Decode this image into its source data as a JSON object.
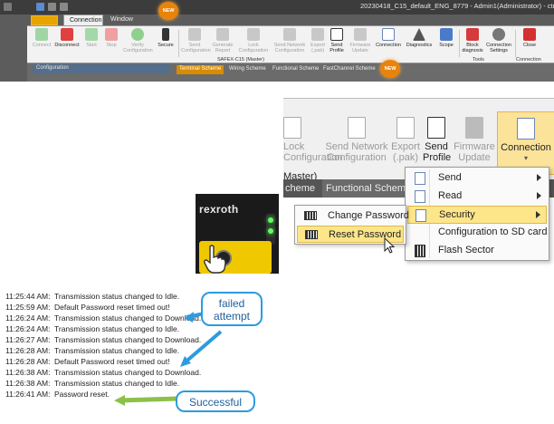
{
  "titlebar": {
    "title": "20230418_C15_default_ENG_8779 - Admin1(Administrator) - ctrlX SAFETY Engineering"
  },
  "ribbon": {
    "tabs": [
      {
        "label": "Connection"
      },
      {
        "label": "Window"
      }
    ],
    "buttons": [
      {
        "label": "Connect",
        "icon": "connect-icon"
      },
      {
        "label": "Disconnect",
        "icon": "disconnect-icon"
      },
      {
        "label": "Start",
        "icon": "play-icon"
      },
      {
        "label": "Stop",
        "icon": "stop-icon"
      },
      {
        "label": "Verify Configuration",
        "icon": "check-icon"
      },
      {
        "label": "Secure",
        "icon": "key-icon"
      },
      {
        "label": "Send Configuration",
        "icon": "send-config-icon"
      },
      {
        "label": "Generate Report",
        "icon": "report-icon"
      },
      {
        "label": "Lock Configuration",
        "icon": "lock-icon"
      },
      {
        "label": "Send Network Configuration",
        "icon": "network-icon"
      },
      {
        "label": "Export (.pak)",
        "icon": "export-icon"
      },
      {
        "label": "Send Profile",
        "icon": "profile-icon"
      },
      {
        "label": "Firmware Update",
        "icon": "firmware-icon"
      },
      {
        "label": "Connection",
        "icon": "connection-icon"
      },
      {
        "label": "Diagnostics",
        "icon": "diagnostics-icon"
      },
      {
        "label": "Scope",
        "icon": "scope-icon"
      },
      {
        "label": "Block diagnosis",
        "icon": "block-icon"
      },
      {
        "label": "Connection Settings",
        "icon": "gear-icon"
      },
      {
        "label": "Close",
        "icon": "close-icon"
      }
    ],
    "group_master": "SAFEX-C15 (Master)",
    "group_tools": "Tools",
    "group_connection": "Connection",
    "new_badge": "NEW"
  },
  "panels": {
    "configuration": "Configuration",
    "doc_tabs": [
      "Terminal Scheme",
      "Wiring Scheme",
      "Functional Scheme",
      "FastChannel Scheme"
    ]
  },
  "zoom": {
    "buttons": [
      {
        "label1": "Lock",
        "label2": "Configuration"
      },
      {
        "label1": "Send Network",
        "label2": "Configuration"
      },
      {
        "label1": "Export",
        "label2": "(.pak)"
      },
      {
        "label1": "Send",
        "label2": "Profile"
      },
      {
        "label1": "Firmware",
        "label2": "Update"
      },
      {
        "label1": "Connection",
        "label2": ""
      }
    ],
    "master": "Master)",
    "bar_left": "cheme",
    "bar_functional": "Functional Scheme"
  },
  "dropdown": {
    "items": [
      {
        "label": "Send",
        "submenu": true
      },
      {
        "label": "Read",
        "submenu": true
      },
      {
        "label": "Security",
        "submenu": true
      },
      {
        "label": "Configuration to SD card",
        "submenu": false
      },
      {
        "label": "Flash Sector",
        "submenu": false
      }
    ]
  },
  "submenu": {
    "items": [
      {
        "label": "Change Password"
      },
      {
        "label": "Reset Password"
      }
    ]
  },
  "device": {
    "brand": "rexroth"
  },
  "log": [
    {
      "time": "11:25:44 AM:",
      "msg": "Transmission status changed to Idle."
    },
    {
      "time": "11:25:59 AM:",
      "msg": "Default Password reset timed out!"
    },
    {
      "time": "11:26:24 AM:",
      "msg": "Transmission status changed to Download."
    },
    {
      "time": "11:26:24 AM:",
      "msg": "Transmission status changed to Idle."
    },
    {
      "time": "11:26:27 AM:",
      "msg": "Transmission status changed to Download."
    },
    {
      "time": "11:26:28 AM:",
      "msg": "Transmission status changed to Idle."
    },
    {
      "time": "11:26:28 AM:",
      "msg": "Default Password reset timed out!"
    },
    {
      "time": "11:26:38 AM:",
      "msg": "Transmission status changed to Download."
    },
    {
      "time": "11:26:38 AM:",
      "msg": "Transmission status changed to Idle."
    },
    {
      "time": "11:26:41 AM:",
      "msg": "Password reset."
    }
  ],
  "callouts": {
    "failed": "failed attempt",
    "success": "Successful"
  },
  "colors": {
    "accent": "#e8a400",
    "highlight": "#fde58a",
    "callout_blue": "#2c9be0",
    "callout_green": "#7fbf3f"
  }
}
